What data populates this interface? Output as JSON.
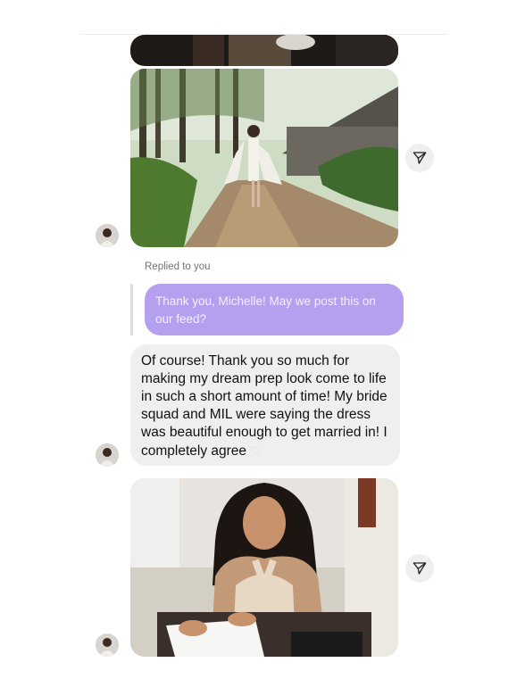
{
  "thread": {
    "replied_label": "Replied to you",
    "quoted_message": "Thank you, Michelle! May we post this on our feed?",
    "reply_message": "Of course! Thank you so much for making my dream prep look come to life in such a short amount of time! My bride squad and MIL were saying the dress was beautiful enough to get married in! I completely agree",
    "reply_emoji": "♡"
  },
  "colors": {
    "quoted_bubble": "#b4a0ef",
    "reply_bubble": "#efefef",
    "share_button": "#efefef"
  },
  "icons": {
    "share": "paper-plane-icon",
    "avatar": "profile-avatar"
  }
}
